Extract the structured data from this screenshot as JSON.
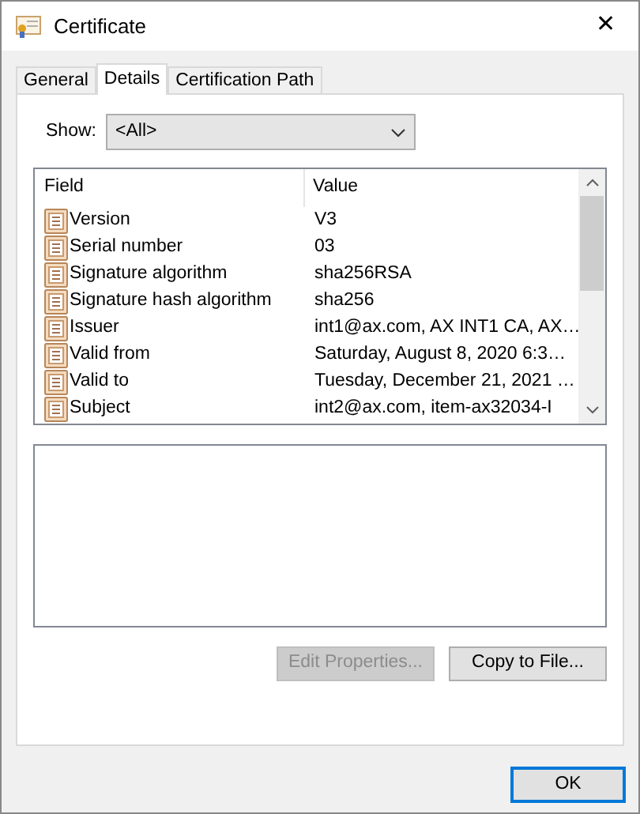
{
  "window": {
    "title": "Certificate",
    "close": "✕"
  },
  "tabs": [
    {
      "label": "General",
      "selected": false
    },
    {
      "label": "Details",
      "selected": true
    },
    {
      "label": "Certification Path",
      "selected": false
    }
  ],
  "show": {
    "label": "Show:",
    "value": "<All>"
  },
  "table": {
    "columns": [
      "Field",
      "Value"
    ],
    "rows": [
      {
        "field": "Version",
        "value": "V3"
      },
      {
        "field": "Serial number",
        "value": "03"
      },
      {
        "field": "Signature algorithm",
        "value": "sha256RSA"
      },
      {
        "field": "Signature hash algorithm",
        "value": "sha256"
      },
      {
        "field": "Issuer",
        "value": "int1@ax.com, AX INT1 CA, AX…"
      },
      {
        "field": "Valid from",
        "value": "Saturday, August 8, 2020 6:3…"
      },
      {
        "field": "Valid to",
        "value": "Tuesday, December 21, 2021 …"
      },
      {
        "field": "Subject",
        "value": "int2@ax.com, item-ax32034-I"
      }
    ]
  },
  "buttons": [
    {
      "label": "Edit Properties...",
      "disabled": true
    },
    {
      "label": "Copy to File...",
      "disabled": false
    }
  ],
  "ok": {
    "label": "OK"
  }
}
